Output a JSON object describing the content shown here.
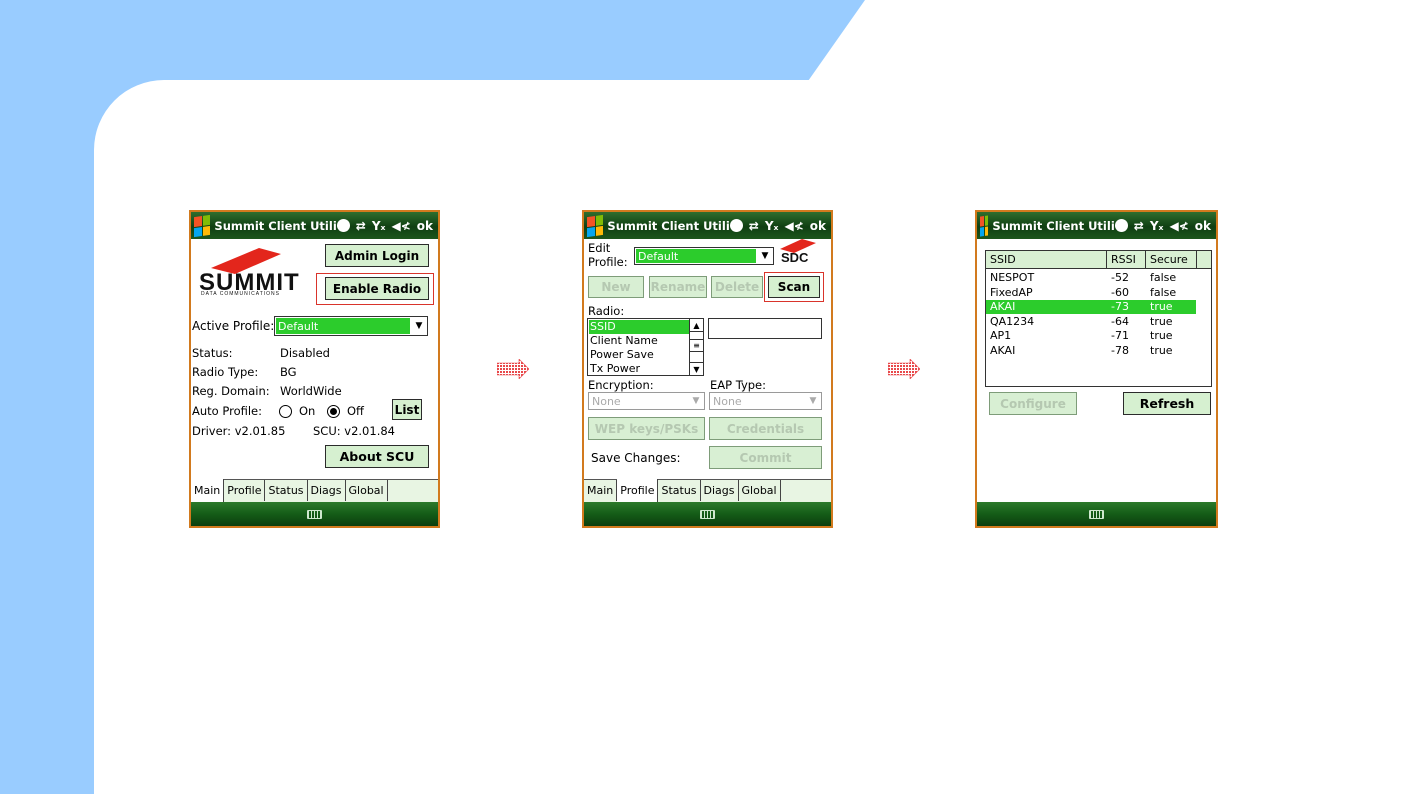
{
  "phones": [
    {
      "title": "Summit Client Utili",
      "ok": "ok",
      "tabs": [
        "Main",
        "Profile",
        "Status",
        "Diags",
        "Global"
      ],
      "active_tab": "Main",
      "logo_text": "SUMMIT",
      "logo_subtext": "DATA COMMUNICATIONS",
      "admin_login_label": "Admin Login",
      "enable_radio_label": "Enable Radio",
      "active_profile_label": "Active Profile:",
      "active_profile_value": "Default",
      "status_label": "Status:",
      "status_value": "Disabled",
      "radio_type_label": "Radio Type:",
      "radio_type_value": "BG",
      "reg_domain_label": "Reg. Domain:",
      "reg_domain_value": "WorldWide",
      "auto_profile_label": "Auto Profile:",
      "on_label": "On",
      "off_label": "Off",
      "auto_profile_selected": "Off",
      "list_label": "List",
      "driver_text": "Driver:  v2.01.85",
      "scu_text": "SCU: v2.01.84",
      "about_label": "About SCU"
    },
    {
      "title": "Summit Client Utili",
      "ok": "ok",
      "tabs": [
        "Main",
        "Profile",
        "Status",
        "Diags",
        "Global"
      ],
      "active_tab": "Profile",
      "edit_label": "Edit",
      "profile_label": "Profile:",
      "profile_value": "Default",
      "sdc_logo": "SDC",
      "new_label": "New",
      "rename_label": "Rename",
      "delete_label": "Delete",
      "scan_label": "Scan",
      "radio_label": "Radio:",
      "radio_items": [
        "SSID",
        "Client Name",
        "Power Save",
        "Tx Power"
      ],
      "radio_selected": "SSID",
      "value_field": "",
      "encryption_label": "Encryption:",
      "encryption_value": "None",
      "eap_label": "EAP Type:",
      "eap_value": "None",
      "wep_label": "WEP keys/PSKs",
      "credentials_label": "Credentials",
      "save_changes_label": "Save Changes:",
      "commit_label": "Commit"
    },
    {
      "title": "Summit Client Utili",
      "ok": "ok",
      "columns": [
        "SSID",
        "RSSI",
        "Secure"
      ],
      "rows": [
        [
          "NESPOT",
          "-52",
          "false"
        ],
        [
          "FixedAP",
          "-60",
          "false"
        ],
        [
          "AKAI",
          "-73",
          "true"
        ],
        [
          "QA1234",
          "-64",
          "true"
        ],
        [
          "AP1",
          "-71",
          "true"
        ],
        [
          "AKAI",
          "-78",
          "true"
        ]
      ],
      "selected_row": 2,
      "configure_label": "Configure",
      "refresh_label": "Refresh"
    }
  ],
  "colors": {
    "slide_blue": "#99ccff",
    "phone_border": "#d27a1e",
    "selection_green": "#2ccc2c",
    "button_green": "#d6f0d0",
    "highlight_red": "#d9342b"
  }
}
